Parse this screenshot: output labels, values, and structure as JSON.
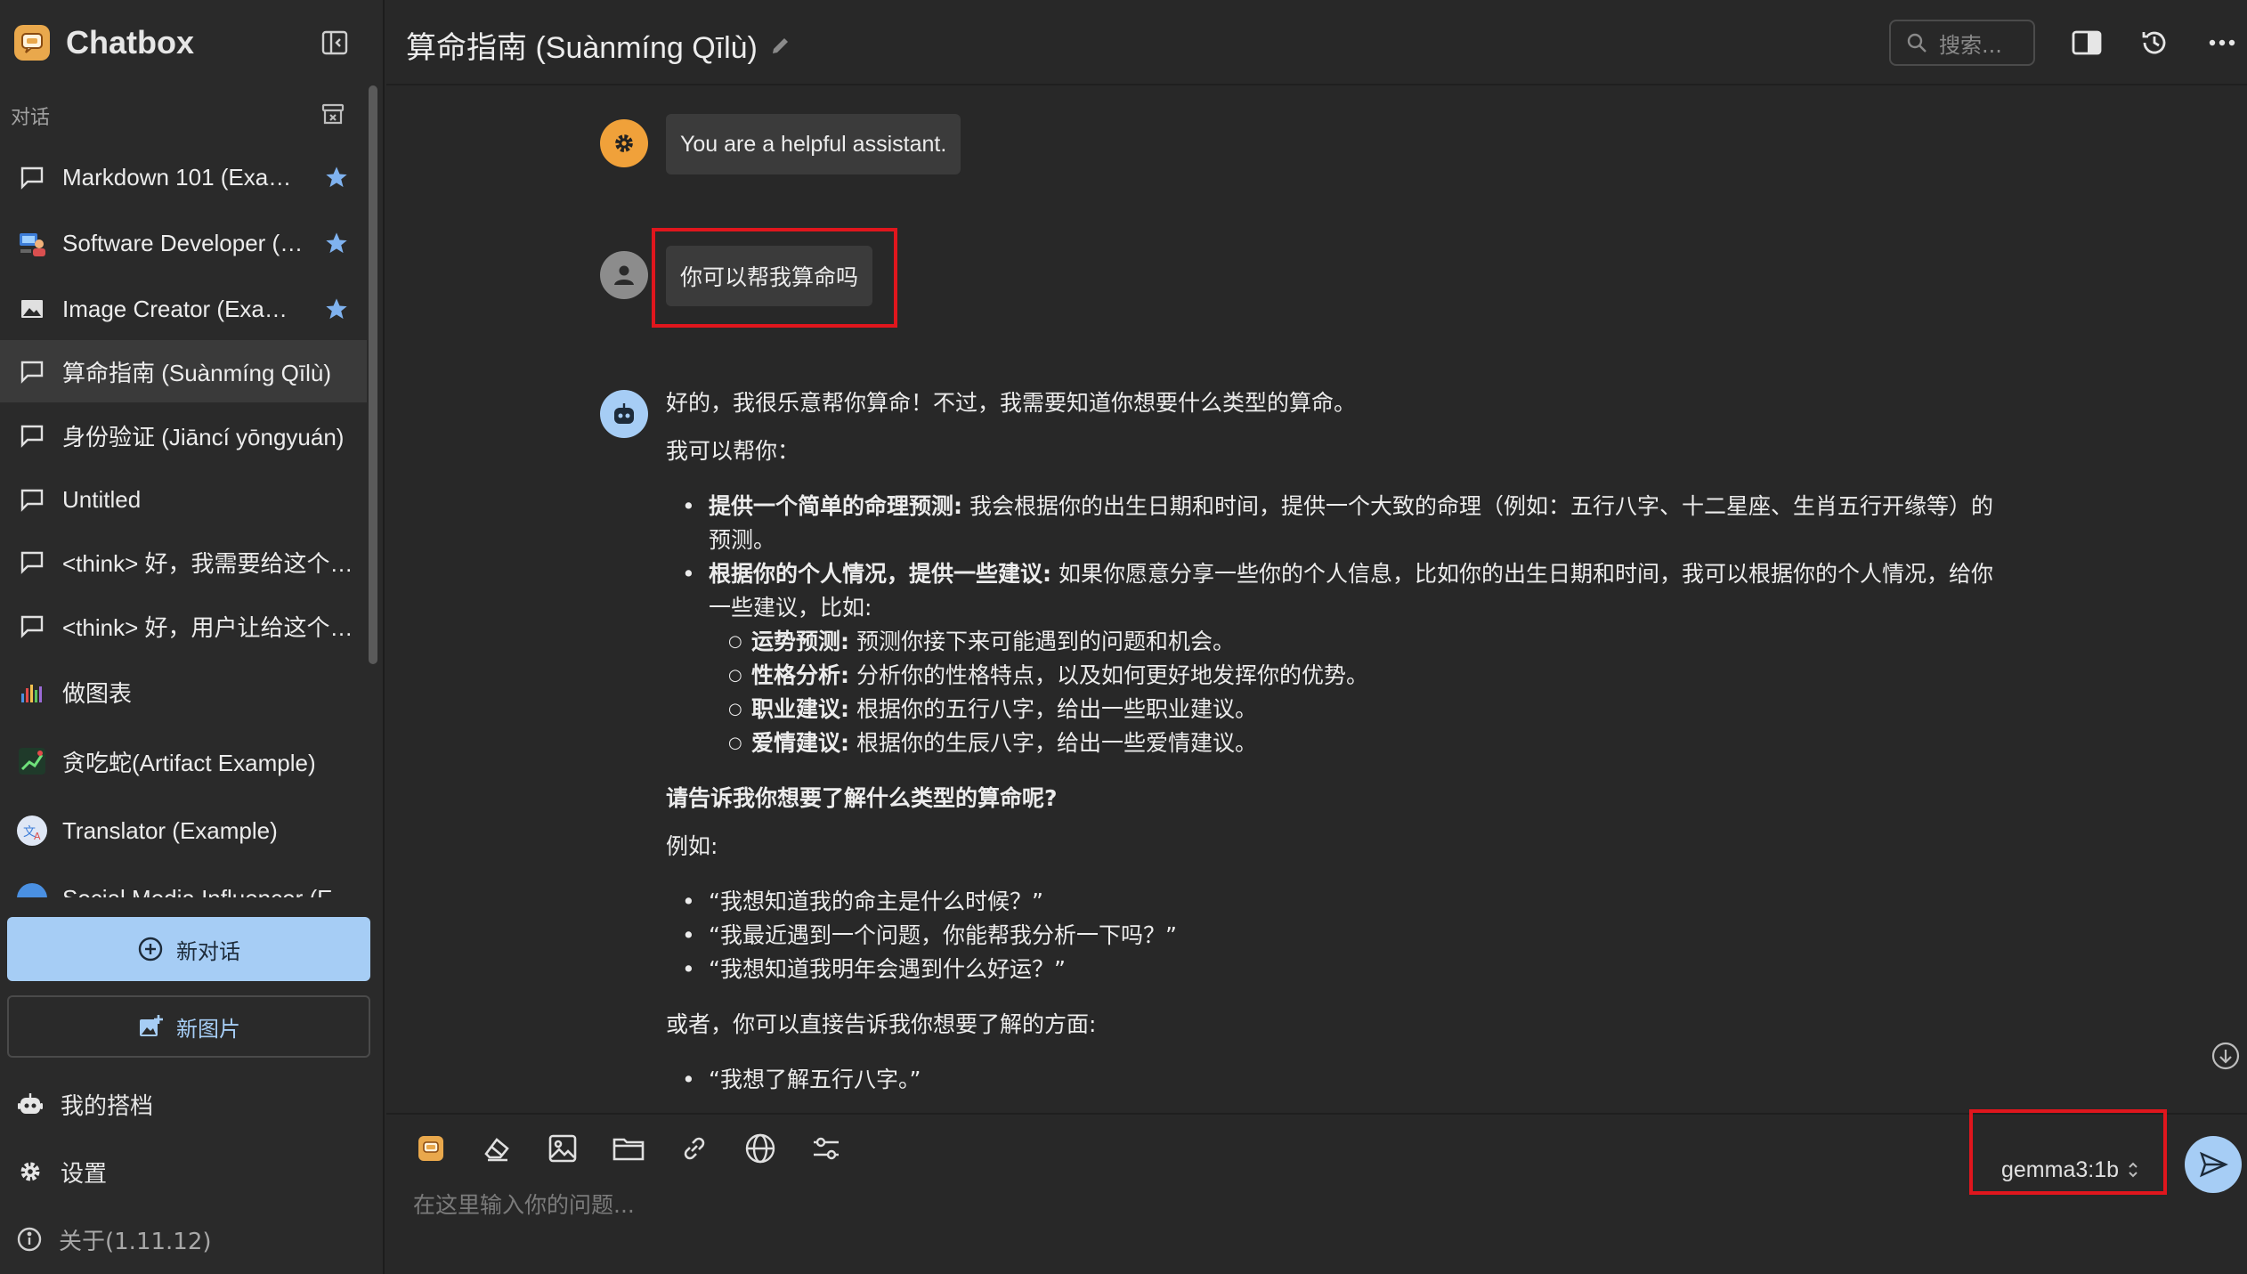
{
  "app": {
    "name": "Chatbox",
    "version_label": "关于(1.11.12)"
  },
  "sidebar": {
    "section_label": "对话",
    "conversations": [
      {
        "label": "Markdown 101 (Exa…",
        "icon": "chat-bubble-icon",
        "starred": true
      },
      {
        "label": "Software Developer (…",
        "icon": "developer-avatar-icon",
        "starred": true
      },
      {
        "label": "Image Creator (Exa…",
        "icon": "image-icon",
        "starred": true
      },
      {
        "label": "算命指南 (Suànmíng Qīlù)",
        "icon": "chat-bubble-icon",
        "starred": false,
        "active": true
      },
      {
        "label": "身份验证 (Jiāncí yōngyuán)",
        "icon": "chat-bubble-icon",
        "starred": false
      },
      {
        "label": "Untitled",
        "icon": "chat-bubble-icon",
        "starred": false
      },
      {
        "label": "<think> 好，我需要给这个…",
        "icon": "chat-bubble-icon",
        "starred": false
      },
      {
        "label": "<think> 好，用户让给这个…",
        "icon": "chat-bubble-icon",
        "starred": false
      },
      {
        "label": "做图表",
        "icon": "chart-icon",
        "starred": false
      },
      {
        "label": "贪吃蛇(Artifact Example)",
        "icon": "snake-game-icon",
        "starred": false
      },
      {
        "label": "Translator (Example)",
        "icon": "translator-avatar-icon",
        "starred": false
      },
      {
        "label": "Social Media Influencer (E…",
        "icon": "social-avatar-icon",
        "starred": false
      }
    ],
    "new_chat_label": "新对话",
    "new_image_label": "新图片",
    "my_copilots_label": "我的搭档",
    "settings_label": "设置",
    "about_label": "关于(1.11.12)"
  },
  "header": {
    "title": "算命指南 (Suànmíng Qīlù)",
    "search_placeholder": "搜索..."
  },
  "messages": {
    "system": "You are a helpful assistant.",
    "user": "你可以帮我算命吗",
    "assistant": {
      "intro": "好的，我很乐意帮你算命！不过，我需要知道你想要什么类型的算命。",
      "can_help": "我可以帮你：",
      "bullet1_bold": "提供一个简单的命理预测:",
      "bullet1_text": " 我会根据你的出生日期和时间，提供一个大致的命理（例如：五行八字、十二星座、生肖五行开缘等）的预测。",
      "bullet2_bold": "根据你的个人情况，提供一些建议:",
      "bullet2_text": " 如果你愿意分享一些你的个人信息，比如你的出生日期和时间，我可以根据你的个人情况，给你一些建议，比如:",
      "sub1_bold": "运势预测:",
      "sub1_text": " 预测你接下来可能遇到的问题和机会。",
      "sub2_bold": "性格分析:",
      "sub2_text": " 分析你的性格特点，以及如何更好地发挥你的优势。",
      "sub3_bold": "职业建议:",
      "sub3_text": " 根据你的五行八字，给出一些职业建议。",
      "sub4_bold": "爱情建议:",
      "sub4_text": " 根据你的生辰八字，给出一些爱情建议。",
      "ask_bold": "请告诉我你想要了解什么类型的算命呢?",
      "example_label": "例如:",
      "examples": [
        "“我想知道我的命主是什么时候？”",
        "“我最近遇到一个问题，你能帮我分析一下吗？”",
        "“我想知道我明年会遇到什么好运？”"
      ],
      "or_text": "或者，你可以直接告诉我你想要了解的方面:",
      "direct": [
        "“我想了解五行八字。”"
      ]
    }
  },
  "input": {
    "placeholder": "在这里输入你的问题...",
    "model": "gemma3:1b"
  },
  "colors": {
    "accent": "#a6cdf5",
    "star": "#7fb2ef",
    "system_avatar": "#f0a13a",
    "highlight": "#e0161d"
  }
}
